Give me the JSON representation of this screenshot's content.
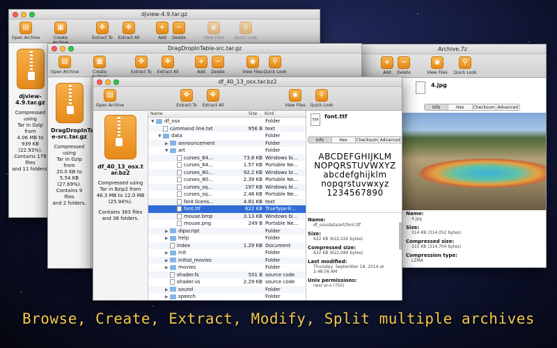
{
  "tagline": "Browse, Create, Extract, Modify, Split multiple archives",
  "toolbar": {
    "open_archive": "Open Archive",
    "create_archive": "Create Archive",
    "extract_to": "Extract To",
    "extract_all": "Extract All",
    "add": "Add",
    "delete": "Delete",
    "view_files": "View Files",
    "quick_look": "Quick Look"
  },
  "win_djview": {
    "title": "djview-4.9.tar.gz",
    "name": "djview-4.9.tar.gz",
    "info_lines": [
      "Compressed using",
      "Tar in Gzip from",
      "4.06 MB to 939 KB",
      "(22.93%).",
      "Contains 179 files",
      "and 11 folders."
    ]
  },
  "win_drag": {
    "title": "DragDropInTable-src.tar.gz",
    "name": "DragDropInTabl e-src.tar.gz",
    "info_lines": [
      "Compressed using",
      "Tar in Gzip from",
      "20.0 KB to 5.54 KB",
      "(27.69%).",
      "Contains 9 files",
      "and 2 folders."
    ]
  },
  "win_7z": {
    "title": "Archive.7z",
    "file_name": "4.jpg",
    "tabs": [
      "Info",
      "Hex",
      "Checksum",
      "Advanced"
    ],
    "info": [
      {
        "label": "Name:",
        "value": "4.jpg"
      },
      {
        "label": "Size:",
        "value": "314 KB (314,052 bytes)"
      },
      {
        "label": "Compressed size:",
        "value": "315 KB (314,704 bytes)"
      },
      {
        "label": "Compression type:",
        "value": "LZMA"
      }
    ]
  },
  "win_main": {
    "title": "df_40_13_osx.tar.bz2",
    "name": "df_40_13_osx.tar.bz2",
    "info_lines": [
      "Compressed using",
      "Tar in Bzip2 from",
      "46.3 MB to 12.0 MB",
      "(25.94%).",
      "",
      "Contains 363 files",
      "and 38 folders."
    ],
    "columns": {
      "name": "Name",
      "size": "Size",
      "kind": "Kind"
    },
    "rows": [
      {
        "name": "df_osx",
        "size": "",
        "kind": "Folder",
        "indent": 0,
        "type": "folder",
        "tri": "▼"
      },
      {
        "name": "command line.txt",
        "size": "956 B",
        "kind": "text",
        "indent": 1,
        "type": "file",
        "tri": ""
      },
      {
        "name": "data",
        "size": "",
        "kind": "Folder",
        "indent": 1,
        "type": "folder",
        "tri": "▼"
      },
      {
        "name": "announcement",
        "size": "",
        "kind": "Folder",
        "indent": 2,
        "type": "folder",
        "tri": "▶"
      },
      {
        "name": "art",
        "size": "",
        "kind": "Folder",
        "indent": 2,
        "type": "folder",
        "tri": "▼"
      },
      {
        "name": "curses_64...",
        "size": "73.8 KB",
        "kind": "Windows bi...",
        "indent": 3,
        "type": "file",
        "tri": ""
      },
      {
        "name": "curses_64...",
        "size": "1.57 KB",
        "kind": "Portable Ne...",
        "indent": 3,
        "type": "file",
        "tri": ""
      },
      {
        "name": "curses_80...",
        "size": "92.2 KB",
        "kind": "Windows bi...",
        "indent": 3,
        "type": "file",
        "tri": ""
      },
      {
        "name": "curses_80...",
        "size": "2.39 KB",
        "kind": "Portable Ne...",
        "indent": 3,
        "type": "file",
        "tri": ""
      },
      {
        "name": "curses_sq...",
        "size": "197 KB",
        "kind": "Windows bi...",
        "indent": 3,
        "type": "file",
        "tri": ""
      },
      {
        "name": "curses_sq...",
        "size": "2.46 KB",
        "kind": "Portable Ne...",
        "indent": 3,
        "type": "file",
        "tri": ""
      },
      {
        "name": "font licens...",
        "size": "4.81 KB",
        "kind": "text",
        "indent": 3,
        "type": "file",
        "tri": ""
      },
      {
        "name": "font.ttf",
        "size": "622 KB",
        "kind": "TrueType®...",
        "indent": 3,
        "type": "file",
        "tri": "",
        "selected": true
      },
      {
        "name": "mouse.bmp",
        "size": "3.13 KB",
        "kind": "Windows bi...",
        "indent": 3,
        "type": "file",
        "tri": ""
      },
      {
        "name": "mouse.png",
        "size": "249 B",
        "kind": "Portable Ne...",
        "indent": 3,
        "type": "file",
        "tri": ""
      },
      {
        "name": "dipscript",
        "size": "",
        "kind": "Folder",
        "indent": 2,
        "type": "folder",
        "tri": "▶"
      },
      {
        "name": "help",
        "size": "",
        "kind": "Folder",
        "indent": 2,
        "type": "folder",
        "tri": "▶"
      },
      {
        "name": "index",
        "size": "1.29 KB",
        "kind": "Document",
        "indent": 2,
        "type": "file",
        "tri": ""
      },
      {
        "name": "init",
        "size": "",
        "kind": "Folder",
        "indent": 2,
        "type": "folder",
        "tri": "▶"
      },
      {
        "name": "initial_movies",
        "size": "",
        "kind": "Folder",
        "indent": 2,
        "type": "folder",
        "tri": "▶"
      },
      {
        "name": "movies",
        "size": "",
        "kind": "Folder",
        "indent": 2,
        "type": "folder",
        "tri": "▶"
      },
      {
        "name": "shader.fs",
        "size": "501 B",
        "kind": "source code",
        "indent": 2,
        "type": "file",
        "tri": ""
      },
      {
        "name": "shader.vs",
        "size": "2.29 KB",
        "kind": "source code",
        "indent": 2,
        "type": "file",
        "tri": ""
      },
      {
        "name": "sound",
        "size": "",
        "kind": "Folder",
        "indent": 2,
        "type": "folder",
        "tri": "▶"
      },
      {
        "name": "speech",
        "size": "",
        "kind": "Folder",
        "indent": 2,
        "type": "folder",
        "tri": "▶"
      }
    ],
    "preview": {
      "file_name": "font.ttf",
      "tabs": [
        "Info",
        "Hex",
        "Checksum",
        "Advanced"
      ],
      "font_lines": [
        "ABCDEFGHIJKLM",
        "NOPQRSTUVWXYZ",
        "abcdefghijklm",
        "nopqrstuvwxyz",
        "1234567890"
      ],
      "info": [
        {
          "label": "Name:",
          "value": "df_osx/data/art/font.ttf"
        },
        {
          "label": "Size:",
          "value": "622 KB (622,020 bytes)"
        },
        {
          "label": "Compressed size:",
          "value": "622 KB (622,080 bytes)"
        },
        {
          "label": "Last modified:",
          "value": "Thursday, September 18, 2014 at 2:48:56 AM"
        },
        {
          "label": "Unix permissions:",
          "value": "rwxr-xr-x (755)"
        }
      ]
    }
  }
}
